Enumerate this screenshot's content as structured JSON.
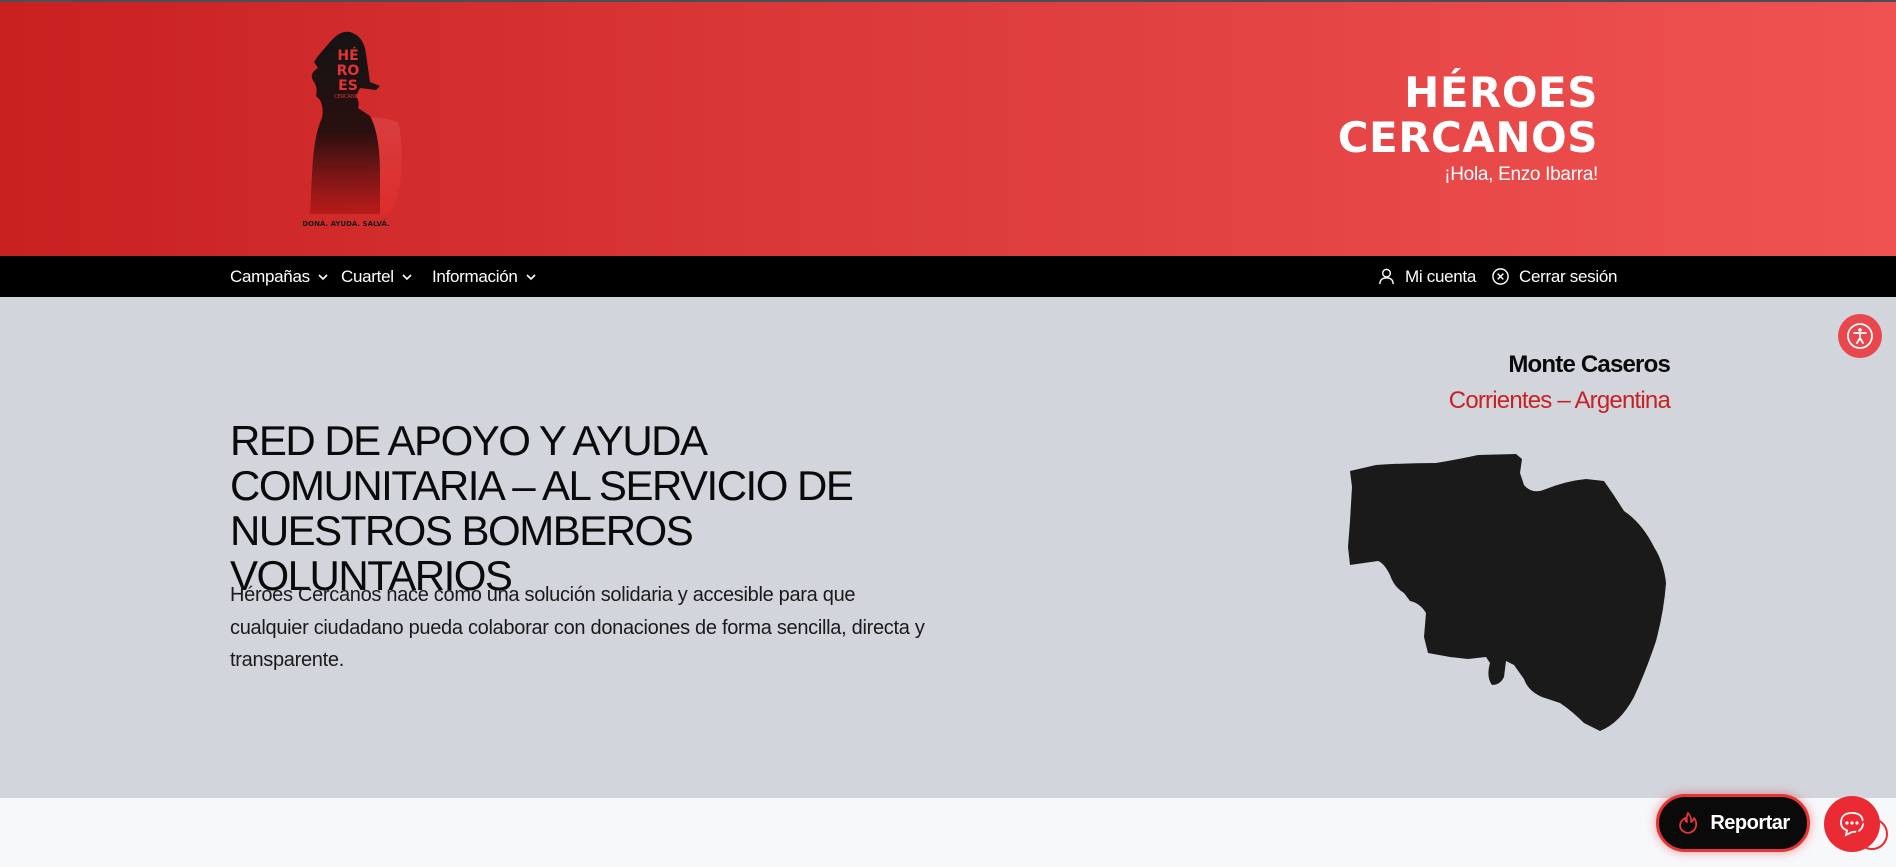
{
  "header": {
    "brand_title": "HÉROES\nCERCANOS",
    "greeting": "¡Hola, Enzo Ibarra!",
    "logo": {
      "icon": "firefighter-silhouette-logo",
      "text_lines": [
        "HÉ",
        "RO",
        "ES"
      ],
      "small_text": "CERCANOS",
      "tagline": "DONÁ. AYUDÁ. SALVÁ."
    }
  },
  "nav": {
    "left": [
      {
        "label": "Campañas",
        "icon": "chevron-down-icon"
      },
      {
        "label": "Cuartel",
        "icon": "chevron-down-icon"
      },
      {
        "label": "Información",
        "icon": "chevron-down-icon"
      }
    ],
    "right": [
      {
        "label": "Mi cuenta",
        "icon": "user-icon"
      },
      {
        "label": "Cerrar sesión",
        "icon": "close-circle-icon"
      }
    ]
  },
  "hero": {
    "heading": "RED DE APOYO Y AYUDA COMUNITARIA – AL SERVICIO DE NUESTROS BOMBEROS VOLUNTARIOS",
    "description": "Héroes Cercanos nace como una solución solidaria y accesible para que cualquier ciudadano pueda colaborar con donaciones de forma sencilla, directa y transparente.",
    "city": "Monte Caseros",
    "province": "Corrientes – Argentina",
    "map_icon": "monte-caseros-map-silhouette"
  },
  "floating": {
    "accessibility_icon": "accessibility-icon",
    "report_label": "Reportar",
    "report_icon": "flame-icon",
    "chat_icon": "chat-bubble-icon"
  },
  "colors": {
    "header_gradient_start": "#c92020",
    "header_gradient_end": "#f05252",
    "nav_bg": "#000000",
    "hero_bg": "#d2d5dc",
    "accent_red": "#c82121"
  }
}
